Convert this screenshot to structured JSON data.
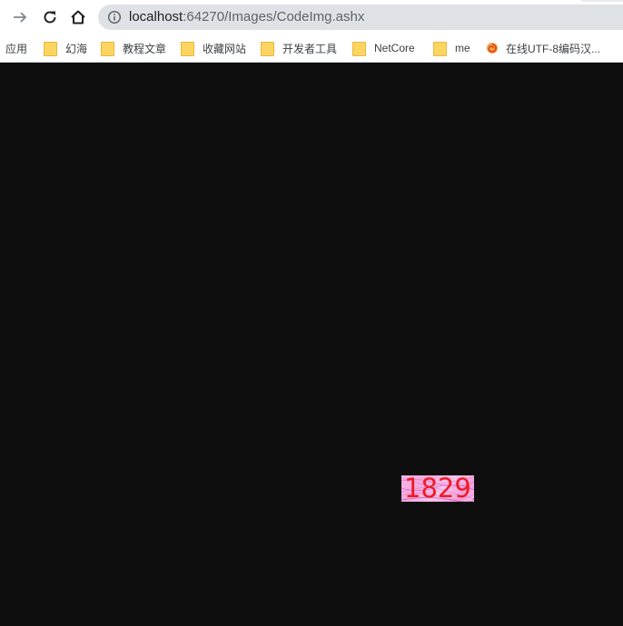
{
  "toolbar": {
    "url_host": "localhost",
    "url_rest": ":64270/Images/CodeImg.ashx"
  },
  "bookmarks": [
    {
      "label": "应用",
      "icon": "apps-grid-icon"
    },
    {
      "label": "幻海",
      "icon": "folder-icon"
    },
    {
      "label": "教程文章",
      "icon": "folder-icon"
    },
    {
      "label": "收藏网站",
      "icon": "folder-icon"
    },
    {
      "label": "开发者工具",
      "icon": "folder-icon"
    },
    {
      "label": "NetCore",
      "icon": "folder-icon"
    },
    {
      "label": "me",
      "icon": "folder-icon"
    },
    {
      "label": "在线UTF-8编码汉...",
      "icon": "site-swirl-icon"
    }
  ],
  "page": {
    "captcha_code": "1829",
    "captcha_color": "#ee1b24",
    "background": "#0e0e0e"
  }
}
